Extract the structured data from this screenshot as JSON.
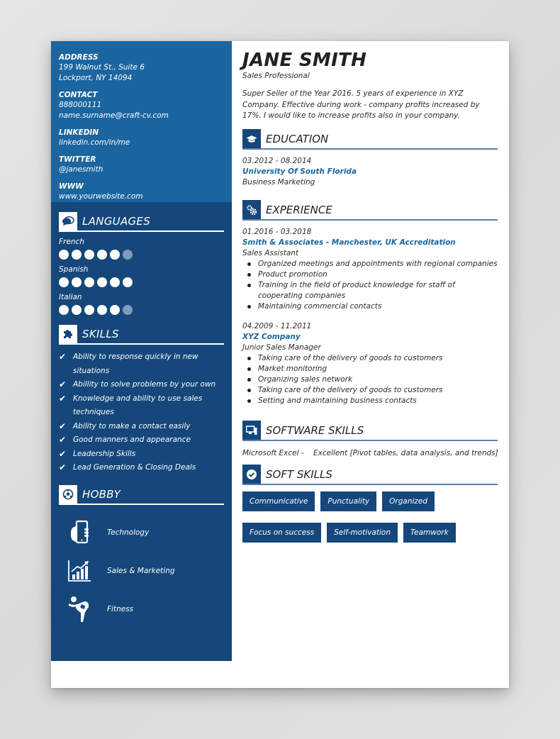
{
  "colors": {
    "sidebar_top": "#1b65a0",
    "sidebar": "#15477b",
    "accent_text": "#1b65a0",
    "dot_inactive": "#7f9bbb"
  },
  "contact": [
    {
      "label": "ADDRESS",
      "lines": [
        "199 Walnut St., Suite 6",
        "Lockport, NY 14094"
      ]
    },
    {
      "label": "CONTACT",
      "lines": [
        "888000111",
        "name.surname@craft-cv.com"
      ]
    },
    {
      "label": "LINKEDIN",
      "lines": [
        "linkedin.com/in/me"
      ]
    },
    {
      "label": "TWITTER",
      "lines": [
        "@janesmith"
      ]
    },
    {
      "label": "WWW",
      "lines": [
        "www.yourwebsite.com"
      ]
    }
  ],
  "languages": {
    "title": "LANGUAGES",
    "icon": "speech-bubbles-icon",
    "items": [
      {
        "name": "French",
        "level": 5,
        "max": 6
      },
      {
        "name": "Spanish",
        "level": 6,
        "max": 6
      },
      {
        "name": "Italian",
        "level": 5,
        "max": 6
      }
    ]
  },
  "skills": {
    "title": "SKILLS",
    "icon": "puzzle-icon",
    "items": [
      "Ability to response quickly in new situations",
      "Abillity to solve problems by your own",
      "Knowledge and ability to use sales techniques",
      "Ability to make a contact easily",
      "Good manners and appearance",
      "Leadership Skills",
      "Lead Generation & Closing Deals"
    ]
  },
  "hobby": {
    "title": "HOBBY",
    "icon": "soccer-ball-icon",
    "items": [
      {
        "label": "Technology",
        "icon": "hand-phone-icon"
      },
      {
        "label": "Sales & Marketing",
        "icon": "growth-chart-icon"
      },
      {
        "label": "Fitness",
        "icon": "yoga-pose-icon"
      }
    ]
  },
  "header": {
    "name": "JANE SMITH",
    "role": "Sales Professional",
    "summary": "Super Seller of the Year 2016. 5 years of experience in XYZ Company. Effective during work - company profits increased by 17%. I would like to increase profits also in your company."
  },
  "education": {
    "title": "EDUCATION",
    "icon": "graduation-cap-icon",
    "entries": [
      {
        "date": "03.2012 - 08.2014",
        "org": "University Of South Florida",
        "detail": "Business Marketing"
      }
    ]
  },
  "experience": {
    "title": "EXPERIENCE",
    "icon": "gears-icon",
    "entries": [
      {
        "date": "01.2016 - 03.2018",
        "org": "Smith & Associates - Manchester, UK Accreditation",
        "position": "Sales Assistant",
        "bullets": [
          "Organized meetings and appointments with regional companies",
          "Product promotion",
          "Training in the field of product knowledge for staff of cooperating companies",
          "Maintaining commercial contacts"
        ]
      },
      {
        "date": "04.2009 - 11.2011",
        "org": "XYZ Company",
        "position": "Junior Sales Manager",
        "bullets": [
          "Taking care of the delivery of goods to customers",
          "Market monitoring",
          "Organizing sales network",
          "Taking care of the delivery of goods to customers",
          "Setting and maintaining business contacts"
        ]
      }
    ]
  },
  "software_skills": {
    "title": "SOFTWARE SKILLS",
    "icon": "computer-icon",
    "line": "Microsoft Excel -    Excellent [Pivot tables, data analysis, and trends]"
  },
  "soft_skills": {
    "title": "SOFT SKILLS",
    "icon": "check-badge-icon",
    "tags": [
      "Communicative",
      "Punctuality",
      "Organized",
      "Focus on success",
      "Self-motivation",
      "Teamwork"
    ]
  }
}
